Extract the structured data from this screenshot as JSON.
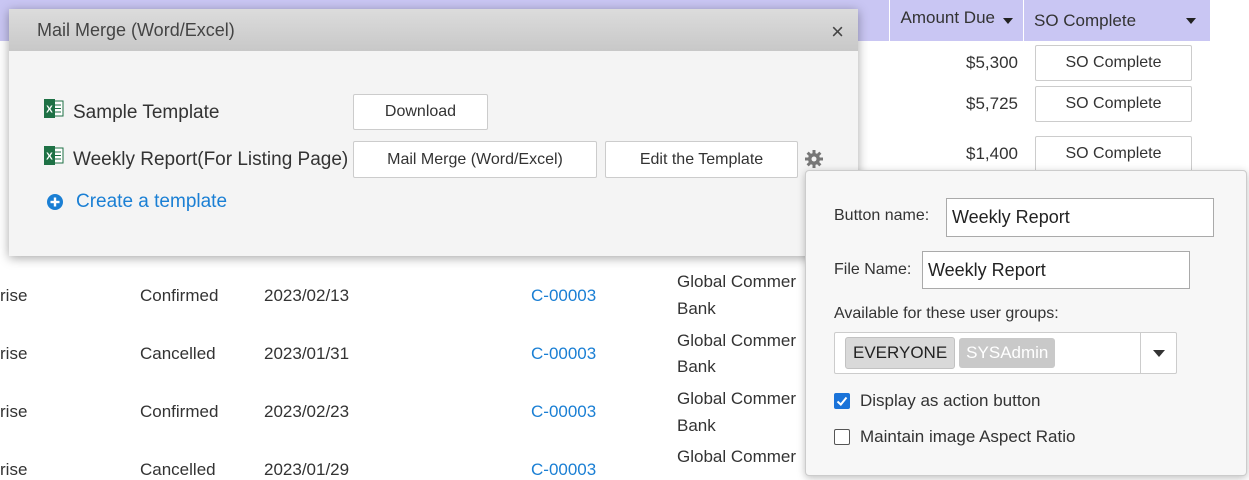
{
  "table": {
    "headers": {
      "amount_due": "Amount Due",
      "so_complete": "SO Complete"
    },
    "top_rows": [
      {
        "amount": "$5,300",
        "button": "SO Complete"
      },
      {
        "amount": "$5,725",
        "button": "SO Complete"
      },
      {
        "amount": "$1,400",
        "button": "SO Complete"
      }
    ],
    "rows": [
      {
        "c1": "rise",
        "status": "Confirmed",
        "date": "2023/02/13",
        "customer_id": "C-00003",
        "customer": "Global Commer",
        "customer2": "Bank"
      },
      {
        "c1": "rise",
        "status": "Cancelled",
        "date": "2023/01/31",
        "customer_id": "C-00003",
        "customer": "Global Commer",
        "customer2": "Bank"
      },
      {
        "c1": "rise",
        "status": "Confirmed",
        "date": "2023/02/23",
        "customer_id": "C-00003",
        "customer": "Global Commer",
        "customer2": "Bank"
      },
      {
        "c1": "rise",
        "status": "Cancelled",
        "date": "2023/01/29",
        "customer_id": "C-00003",
        "customer": "Global Commer",
        "customer2": ""
      }
    ]
  },
  "dialog": {
    "title": "Mail Merge (Word/Excel)",
    "close": "×",
    "sample_template": "Sample Template",
    "download_label": "Download",
    "weekly_report": "Weekly Report(For Listing Page)",
    "mail_merge_label": "Mail Merge (Word/Excel)",
    "edit_template_label": "Edit the Template",
    "create_template": "Create a template"
  },
  "popover": {
    "button_name_label": "Button name:",
    "button_name_value": "Weekly Report",
    "file_name_label": "File Name:",
    "file_name_value": "Weekly Report",
    "groups_label": "Available for these user groups:",
    "groups": [
      "EVERYONE",
      "SYSAdmin"
    ],
    "display_action_label": "Display as action button",
    "display_action_checked": true,
    "aspect_ratio_label": "Maintain image Aspect Ratio",
    "aspect_ratio_checked": false
  },
  "colors": {
    "header_bg": "#c9c6f3",
    "link": "#1a7fd4",
    "checkbox_checked": "#1a73d9",
    "excel_green": "#1e7145"
  }
}
